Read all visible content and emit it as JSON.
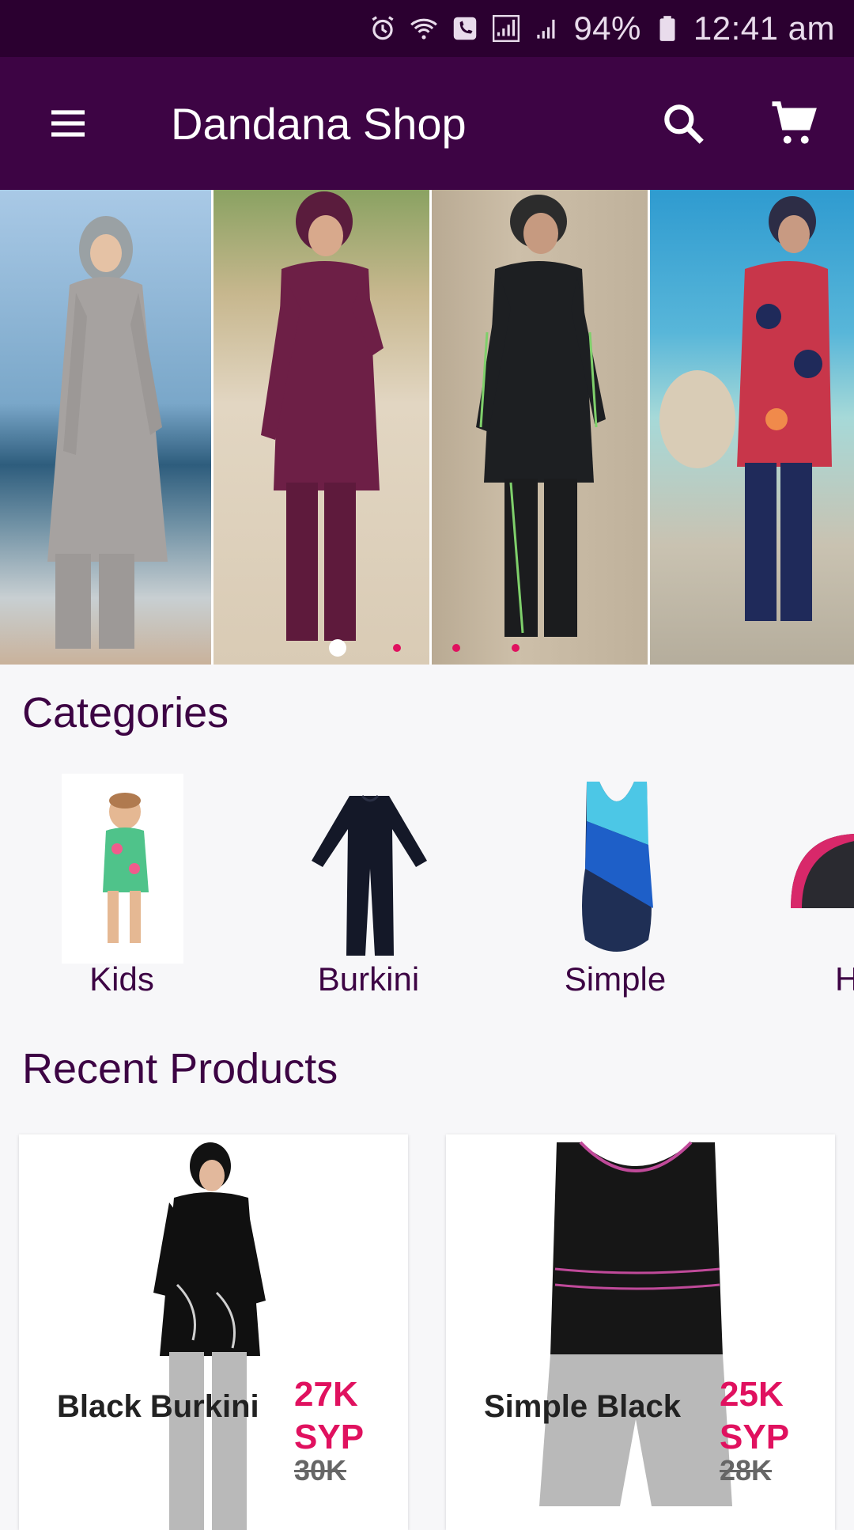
{
  "status_bar": {
    "battery": "94%",
    "time": "12:41 am",
    "icons": [
      "alarm-icon",
      "wifi-calling-icon",
      "phone-icon",
      "signal-icon",
      "signal-2-icon",
      "battery-icon"
    ]
  },
  "app_bar": {
    "title": "Dandana Shop",
    "menu_icon": "menu-icon",
    "search_icon": "search-icon",
    "cart_icon": "cart-icon",
    "color": "#3d0444"
  },
  "banner": {
    "slides": 4,
    "active_index": 0
  },
  "categories": {
    "heading": "Categories",
    "items": [
      {
        "label": "Kids"
      },
      {
        "label": "Burkini"
      },
      {
        "label": "Simple"
      },
      {
        "label": "H"
      }
    ]
  },
  "recent_products": {
    "heading": "Recent Products",
    "items": [
      {
        "name": "Black Burkini",
        "price": "27K SYP",
        "old_price": "30K"
      },
      {
        "name": "Simple Black",
        "price": "25K SYP",
        "old_price": "28K"
      }
    ]
  },
  "colors": {
    "primary_dark": "#2b0030",
    "primary": "#3d0444",
    "accent": "#e0115f"
  }
}
